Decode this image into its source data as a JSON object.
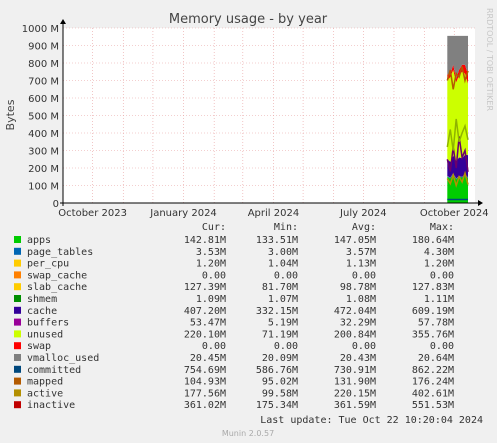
{
  "chart_data": {
    "type": "area",
    "title": "Memory usage - by year",
    "ylabel": "Bytes",
    "xlabel": "",
    "ylim": [
      0,
      1000
    ],
    "y_unit": "M",
    "y_ticks": [
      0,
      100,
      200,
      300,
      400,
      500,
      600,
      700,
      800,
      900,
      1000
    ],
    "y_tick_labels": [
      "0",
      "100 M",
      "200 M",
      "300 M",
      "400 M",
      "500 M",
      "600 M",
      "700 M",
      "800 M",
      "900 M",
      "1000 M"
    ],
    "x_ticks": [
      {
        "label": "October 2023",
        "date": "2023-10-01"
      },
      {
        "label": "January 2024",
        "date": "2024-01-01"
      },
      {
        "label": "April 2024",
        "date": "2024-04-01"
      },
      {
        "label": "July 2024",
        "date": "2024-07-01"
      },
      {
        "label": "October 2024",
        "date": "2024-10-01"
      }
    ],
    "xlim": [
      "2023-09-01",
      "2024-10-22"
    ],
    "data_start": "2024-09-24",
    "grid": true,
    "legend_columns": [
      "Cur:",
      "Min:",
      "Avg:",
      "Max:"
    ],
    "series": [
      {
        "name": "apps",
        "color": "#00cc00",
        "cur": "142.81M",
        "min": "133.51M",
        "avg": "147.05M",
        "max": "180.64M",
        "stacked_top": [
          150,
          140,
          165,
          135,
          150,
          145,
          160,
          142
        ]
      },
      {
        "name": "page_tables",
        "color": "#0066b3",
        "cur": "3.53M",
        "min": "3.00M",
        "avg": "3.57M",
        "max": "4.30M",
        "stacked_top": [
          154,
          144,
          169,
          139,
          154,
          149,
          164,
          146
        ]
      },
      {
        "name": "per_cpu",
        "color": "#ff8000",
        "cur": "1.20M",
        "min": "1.04M",
        "avg": "1.13M",
        "max": "1.20M",
        "stacked_top": [
          155,
          145,
          170,
          140,
          155,
          150,
          165,
          147
        ]
      },
      {
        "name": "swap_cache",
        "color": "#ffcc00",
        "cur": "0.00",
        "min": "0.00",
        "avg": "0.00",
        "max": "0.00",
        "stacked_top": [
          155,
          145,
          170,
          140,
          155,
          150,
          165,
          147
        ]
      },
      {
        "name": "slab_cache",
        "color": "#330099",
        "cur": "127.39M",
        "min": "81.70M",
        "avg": "98.78M",
        "max": "127.83M",
        "stacked_top": [
          250,
          235,
          270,
          240,
          260,
          255,
          275,
          274
        ]
      },
      {
        "name": "shmem",
        "color": "#990099",
        "cur": "1.09M",
        "min": "1.07M",
        "avg": "1.08M",
        "max": "1.11M",
        "stacked_top": [
          251,
          236,
          271,
          241,
          261,
          256,
          276,
          275
        ]
      },
      {
        "name": "cache",
        "color": "#ccff00",
        "cur": "407.20M",
        "min": "332.15M",
        "avg": "472.04M",
        "max": "609.19M",
        "stacked_top": [
          700,
          720,
          760,
          690,
          730,
          750,
          740,
          682
        ]
      },
      {
        "name": "buffers",
        "color": "#ff0000",
        "cur": "53.47M",
        "min": "5.19M",
        "avg": "32.29M",
        "max": "57.78M",
        "stacked_top": [
          735,
          735,
          790,
          710,
          760,
          790,
          790,
          735
        ]
      },
      {
        "name": "unused",
        "color": "#808080",
        "cur": "220.10M",
        "min": "71.19M",
        "avg": "200.84M",
        "max": "355.76M",
        "stacked_top": [
          955,
          955,
          955,
          955,
          955,
          955,
          955,
          955
        ]
      },
      {
        "name": "swap",
        "color": "#008f00",
        "cur": "0.00",
        "min": "0.00",
        "avg": "0.00",
        "max": "0.00",
        "stacked_top": [
          955,
          955,
          955,
          955,
          955,
          955,
          955,
          955
        ]
      },
      {
        "name": "vmalloc_used",
        "color": "#00487d",
        "cur": "20.45M",
        "min": "20.09M",
        "avg": "20.43M",
        "max": "20.64M",
        "line": [
          20,
          20,
          20,
          20,
          20,
          20,
          20,
          20
        ]
      },
      {
        "name": "committed",
        "color": "#b35a00",
        "cur": "754.69M",
        "min": "586.76M",
        "avg": "730.91M",
        "max": "862.22M",
        "line": [
          700,
          760,
          650,
          740,
          720,
          780,
          700,
          755
        ]
      },
      {
        "name": "mapped",
        "color": "#b38f00",
        "cur": "104.93M",
        "min": "95.02M",
        "avg": "131.90M",
        "max": "176.24M",
        "line": [
          140,
          110,
          160,
          100,
          150,
          120,
          170,
          105
        ]
      },
      {
        "name": "active",
        "color": "#6b006b",
        "cur": "177.56M",
        "min": "99.58M",
        "avg": "220.15M",
        "max": "402.61M",
        "line": [
          250,
          180,
          320,
          200,
          380,
          260,
          300,
          178
        ]
      },
      {
        "name": "inactive",
        "color": "#8fb300",
        "cur": "361.02M",
        "min": "175.34M",
        "avg": "361.59M",
        "max": "551.53M",
        "line": [
          320,
          420,
          300,
          480,
          350,
          400,
          440,
          361
        ]
      }
    ],
    "legend_colors": [
      "#00cc00",
      "#0066b3",
      "#ffcc00",
      "#ff8000",
      "#ffcc00",
      "#008f00",
      "#330099",
      "#990099",
      "#ccff00",
      "#ff0000",
      "#808080",
      "#00487d",
      "#b35a00",
      "#b38f00",
      "#c00000"
    ]
  },
  "footer": {
    "last_update": "Last update: Tue Oct 22 10:20:04 2024",
    "munin_version": "Munin 2.0.57"
  },
  "watermark": "RRDTOOL / TOBI OETIKER"
}
